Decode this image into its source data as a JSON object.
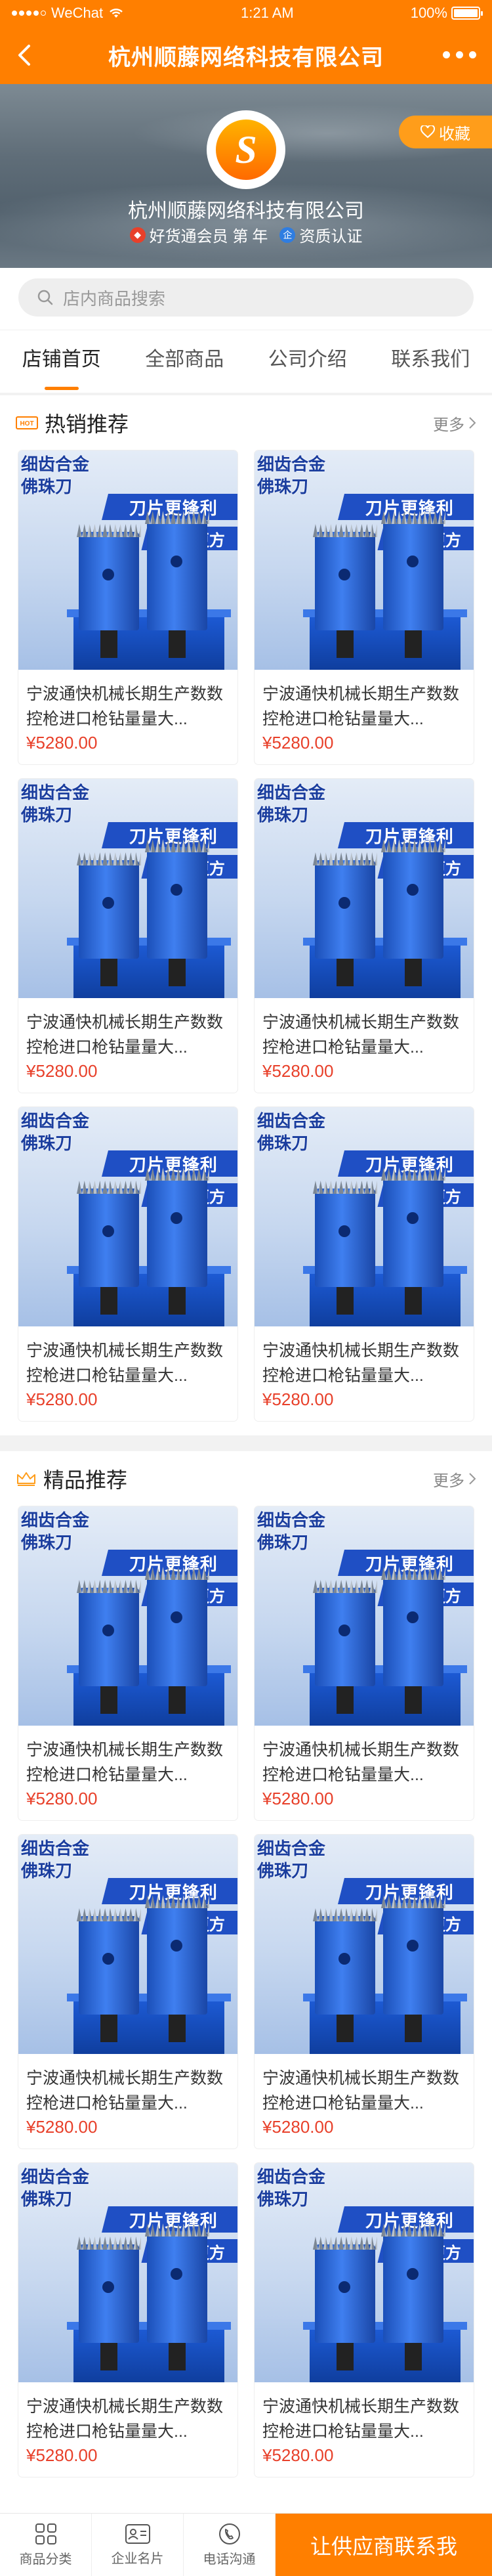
{
  "status": {
    "carrier": "WeChat",
    "time": "1:21 AM",
    "battery": "100%"
  },
  "header": {
    "title": "杭州顺藤网络科技有限公司"
  },
  "shop": {
    "name": "杭州顺藤网络科技有限公司",
    "favorite_label": "收藏",
    "member_text": "好货通会员 第",
    "member_unit": "年",
    "cert_text": "资质认证",
    "logo_letter": "S"
  },
  "search": {
    "placeholder": "店内商品搜索"
  },
  "tabs": [
    {
      "label": "店铺首页"
    },
    {
      "label": "全部商品"
    },
    {
      "label": "公司介绍"
    },
    {
      "label": "联系我们"
    }
  ],
  "hot": {
    "title": "热销推荐",
    "more": "更多",
    "products": [
      {
        "name": "宁波通快机械长期生产数数控枪进口枪钻量量大...",
        "price": "¥5280.00",
        "img_tag": "细齿合金 佛珠刀",
        "img_line1": "刀片更锋利",
        "img_line2": "成型更方"
      },
      {
        "name": "宁波通快机械长期生产数数控枪进口枪钻量量大...",
        "price": "¥5280.00",
        "img_tag": "细齿合金 佛珠刀",
        "img_line1": "刀片更锋利",
        "img_line2": "成型更方"
      },
      {
        "name": "宁波通快机械长期生产数数控枪进口枪钻量量大...",
        "price": "¥5280.00",
        "img_tag": "细齿合金 佛珠刀",
        "img_line1": "刀片更锋利",
        "img_line2": "成型更方"
      },
      {
        "name": "宁波通快机械长期生产数数控枪进口枪钻量量大...",
        "price": "¥5280.00",
        "img_tag": "细齿合金 佛珠刀",
        "img_line1": "刀片更锋利",
        "img_line2": "成型更方"
      },
      {
        "name": "宁波通快机械长期生产数数控枪进口枪钻量量大...",
        "price": "¥5280.00",
        "img_tag": "细齿合金 佛珠刀",
        "img_line1": "刀片更锋利",
        "img_line2": "成型更方"
      },
      {
        "name": "宁波通快机械长期生产数数控枪进口枪钻量量大...",
        "price": "¥5280.00",
        "img_tag": "细齿合金 佛珠刀",
        "img_line1": "刀片更锋利",
        "img_line2": "成型更方"
      }
    ]
  },
  "featured": {
    "title": "精品推荐",
    "more": "更多",
    "products": [
      {
        "name": "宁波通快机械长期生产数数控枪进口枪钻量量大...",
        "price": "¥5280.00",
        "img_tag": "细齿合金 佛珠刀",
        "img_line1": "刀片更锋利",
        "img_line2": "成型更方"
      },
      {
        "name": "宁波通快机械长期生产数数控枪进口枪钻量量大...",
        "price": "¥5280.00",
        "img_tag": "细齿合金 佛珠刀",
        "img_line1": "刀片更锋利",
        "img_line2": "成型更方"
      },
      {
        "name": "宁波通快机械长期生产数数控枪进口枪钻量量大...",
        "price": "¥5280.00",
        "img_tag": "细齿合金 佛珠刀",
        "img_line1": "刀片更锋利",
        "img_line2": "成型更方"
      },
      {
        "name": "宁波通快机械长期生产数数控枪进口枪钻量量大...",
        "price": "¥5280.00",
        "img_tag": "细齿合金 佛珠刀",
        "img_line1": "刀片更锋利",
        "img_line2": "成型更方"
      },
      {
        "name": "宁波通快机械长期生产数数控枪进口枪钻量量大...",
        "price": "¥5280.00",
        "img_tag": "细齿合金 佛珠刀",
        "img_line1": "刀片更锋利",
        "img_line2": "成型更方"
      },
      {
        "name": "宁波通快机械长期生产数数控枪进口枪钻量量大...",
        "price": "¥5280.00",
        "img_tag": "细齿合金 佛珠刀",
        "img_line1": "刀片更锋利",
        "img_line2": "成型更方"
      }
    ]
  },
  "bottom": {
    "items": [
      {
        "label": "商品分类",
        "icon": "grid-icon"
      },
      {
        "label": "企业名片",
        "icon": "card-icon"
      },
      {
        "label": "电话沟通",
        "icon": "phone-icon"
      }
    ],
    "cta": "让供应商联系我"
  },
  "colors": {
    "accent": "#ff7f00",
    "price": "#e8402a",
    "favorite": "#ff9d1a"
  }
}
